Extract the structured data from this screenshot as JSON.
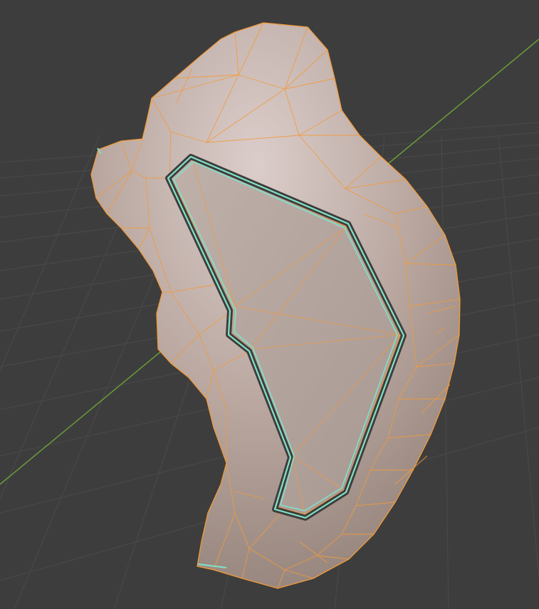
{
  "viewport": {
    "mode": "edit-mode",
    "view": "perspective"
  },
  "colors": {
    "background": "#3d3d3d",
    "grid_line": "#4a4a4a",
    "x_axis": "#7b3b3b",
    "y_axis": "#6c9a3a",
    "mesh_surface_light": "#d9cdca",
    "mesh_surface_mid": "#b5a29b",
    "mesh_surface_dark": "#8c7c74",
    "mesh_selected_wire": "#f29a3a",
    "mesh_edge_selected": "#7fe2c9",
    "mesh_edge_dark": "#3f3d3b"
  },
  "object": {
    "name_visible": "",
    "shape": "extruded-organic-outline",
    "selection": "all-faces-selected"
  }
}
